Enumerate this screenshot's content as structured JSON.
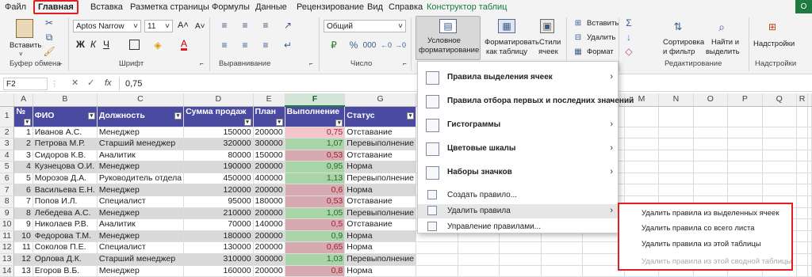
{
  "tabs": [
    "Файл",
    "Главная",
    "Вставка",
    "Разметка страницы",
    "Формулы",
    "Данные",
    "Рецензирование",
    "Вид",
    "Справка",
    "Конструктор таблиц"
  ],
  "ribbon": {
    "paste": "Вставить",
    "groups": {
      "clipboard": "Буфер обмена",
      "font": "Шрифт",
      "align": "Выравнивание",
      "number": "Число",
      "editing": "Редактирование",
      "addins": "Надстройки"
    },
    "font_name": "Aptos Narrow",
    "font_size": "11",
    "number_format": "Общий",
    "cond_format": [
      "Условное",
      "форматирование"
    ],
    "format_as_table": [
      "Форматировать",
      "как таблицу"
    ],
    "styles": [
      "Стили",
      "ячеек"
    ],
    "cells": {
      "insert": "Вставить",
      "delete": "Удалить",
      "format": "Формат"
    },
    "sort": [
      "Сортировка",
      "и фильтр"
    ],
    "find": [
      "Найти и",
      "выделить"
    ],
    "addins": "Надстройки",
    "dialog_char": "⌐",
    "user_badge": "О"
  },
  "formula_bar": {
    "cell_ref": "F2",
    "fx": "fx",
    "value": "0,75",
    "cancel": "✕",
    "enter": "✓"
  },
  "columns": [
    "A",
    "B",
    "C",
    "D",
    "E",
    "F",
    "G",
    "H",
    "I",
    "J",
    "K",
    "L",
    "M",
    "N",
    "O",
    "P",
    "Q",
    "R"
  ],
  "table_headers": [
    "№",
    "ФИО",
    "Должность",
    "Сумма продаж",
    "План",
    "Выполнение",
    "Статус"
  ],
  "rows": [
    {
      "n": "1",
      "name": "Иванов А.С.",
      "pos": "Менеджер",
      "sum": "150000",
      "plan": "200000",
      "perf": "0,75",
      "status": "Отставание"
    },
    {
      "n": "2",
      "name": "Петрова М.Р.",
      "pos": "Старший менеджер",
      "sum": "320000",
      "plan": "300000",
      "perf": "1,07",
      "status": "Перевыполнение"
    },
    {
      "n": "3",
      "name": "Сидоров К.В.",
      "pos": "Аналитик",
      "sum": "80000",
      "plan": "150000",
      "perf": "0,53",
      "status": "Отставание"
    },
    {
      "n": "4",
      "name": "Кузнецова О.И.",
      "pos": "Менеджер",
      "sum": "190000",
      "plan": "200000",
      "perf": "0,95",
      "status": "Норма"
    },
    {
      "n": "5",
      "name": "Морозов Д.А.",
      "pos": "Руководитель отдела",
      "sum": "450000",
      "plan": "400000",
      "perf": "1,13",
      "status": "Перевыполнение"
    },
    {
      "n": "6",
      "name": "Васильева Е.Н.",
      "pos": "Менеджер",
      "sum": "120000",
      "plan": "200000",
      "perf": "0,6",
      "status": "Норма"
    },
    {
      "n": "7",
      "name": "Попов И.Л.",
      "pos": "Специалист",
      "sum": "95000",
      "plan": "180000",
      "perf": "0,53",
      "status": "Отставание"
    },
    {
      "n": "8",
      "name": "Лебедева А.С.",
      "pos": "Менеджер",
      "sum": "210000",
      "plan": "200000",
      "perf": "1,05",
      "status": "Перевыполнение"
    },
    {
      "n": "9",
      "name": "Николаев Р.В.",
      "pos": "Аналитик",
      "sum": "70000",
      "plan": "140000",
      "perf": "0,5",
      "status": "Отставание"
    },
    {
      "n": "10",
      "name": "Федорова Т.М.",
      "pos": "Менеджер",
      "sum": "180000",
      "plan": "200000",
      "perf": "0,9",
      "status": "Норма"
    },
    {
      "n": "11",
      "name": "Соколов П.Е.",
      "pos": "Специалист",
      "sum": "130000",
      "plan": "200000",
      "perf": "0,65",
      "status": "Норма"
    },
    {
      "n": "12",
      "name": "Орлова Д.К.",
      "pos": "Старший менеджер",
      "sum": "310000",
      "plan": "300000",
      "perf": "1,03",
      "status": "Перевыполнение"
    },
    {
      "n": "13",
      "name": "Егоров В.Б.",
      "pos": "Менеджер",
      "sum": "160000",
      "plan": "200000",
      "perf": "0,8",
      "status": "Норма"
    }
  ],
  "menu": {
    "items": [
      {
        "label": "Правила выделения ячеек",
        "has_sub": true,
        "bold": true
      },
      {
        "label": "Правила отбора первых и последних значений",
        "has_sub": true,
        "bold": true
      },
      {
        "label": "Гистограммы",
        "has_sub": true,
        "bold": true
      },
      {
        "label": "Цветовые шкалы",
        "has_sub": true,
        "bold": true
      },
      {
        "label": "Наборы значков",
        "has_sub": true,
        "bold": true
      },
      {
        "label": "Создать правило...",
        "has_sub": false,
        "bold": false
      },
      {
        "label": "Удалить правила",
        "has_sub": true,
        "bold": false
      },
      {
        "label": "Управление правилами...",
        "has_sub": false,
        "bold": false
      }
    ],
    "arrow": "›"
  },
  "submenu": [
    {
      "label": "Удалить правила из выделенных ячеек",
      "disabled": false
    },
    {
      "label": "Удалить правила со всего листа",
      "disabled": false
    },
    {
      "label": "Удалить правила из этой таблицы",
      "disabled": false
    },
    {
      "label": "Удалить правила из этой сводной таблицы",
      "disabled": true
    }
  ]
}
